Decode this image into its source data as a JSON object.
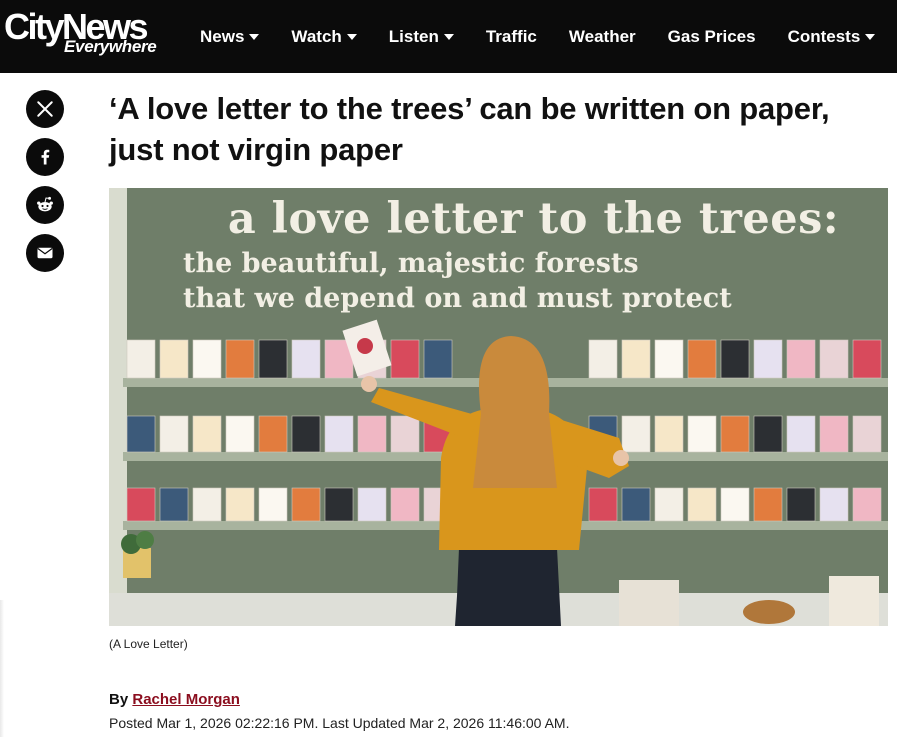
{
  "brand": {
    "name": "CityNews",
    "tagline": "Everywhere"
  },
  "nav": {
    "items": [
      {
        "label": "News",
        "dropdown": true
      },
      {
        "label": "Watch",
        "dropdown": true
      },
      {
        "label": "Listen",
        "dropdown": true
      },
      {
        "label": "Traffic",
        "dropdown": false
      },
      {
        "label": "Weather",
        "dropdown": false
      },
      {
        "label": "Gas Prices",
        "dropdown": false
      },
      {
        "label": "Contests",
        "dropdown": true
      }
    ]
  },
  "share": [
    "x-icon",
    "facebook-icon",
    "reddit-icon",
    "email-icon"
  ],
  "article": {
    "headline": "‘A love letter to the trees’ can be written on paper, just not virgin paper",
    "image_caption": "(A Love Letter)",
    "byline_prefix": "By",
    "author": "Rachel Morgan",
    "dates": "Posted Mar 1, 2026 02:22:16 PM.  Last Updated Mar 2, 2026 11:46:00 AM."
  },
  "hero": {
    "wall_text_1": "a love letter to the trees:",
    "wall_text_2": "the beautiful, majestic forests",
    "wall_text_3": "that we depend on and must protect"
  },
  "colors": {
    "header_bg": "#0b0b0b",
    "author_link": "#8b0d1e",
    "wall": "#6f7e69"
  }
}
